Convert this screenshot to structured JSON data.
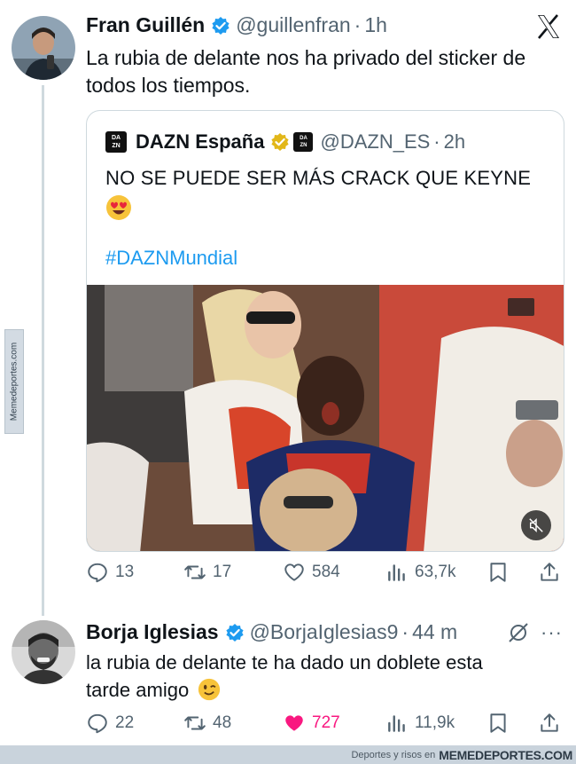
{
  "tweet1": {
    "name": "Fran Guillén",
    "handle": "@guillenfran",
    "time": "1h",
    "text_line1": "La rubia de delante nos ha privado del sticker de",
    "text_line2": "todos los tiempos."
  },
  "quote": {
    "name": "DAZN España",
    "handle": "@DAZN_ES",
    "time": "2h",
    "text": "NO SE PUEDE SER MÁS CRACK QUE KEYNE",
    "emoji": "😍",
    "hashtag": "#DAZNMundial",
    "logo_line1": "DA",
    "logo_line2": "ZN"
  },
  "tweet1_actions": {
    "replies": "13",
    "retweets": "17",
    "likes": "584",
    "views": "63,7k"
  },
  "tweet2": {
    "name": "Borja Iglesias",
    "handle": "@BorjaIglesias9",
    "time": "44 m",
    "text_line1": "la rubia de delante te ha dado un doblete esta",
    "text_line2": "tarde amigo",
    "emoji": "😉"
  },
  "tweet2_actions": {
    "replies": "22",
    "retweets": "48",
    "likes": "727",
    "views": "11,9k"
  },
  "separator": "·",
  "more": "···",
  "watermark_side": "Memedeportes.com",
  "footer": {
    "left": "Deportes y risos en",
    "right": "MEMEDEPORTES.COM"
  },
  "colors": {
    "accent": "#1d9bf0",
    "like": "#f91880",
    "muted": "#536471",
    "verified": "#1d9bf0",
    "gold": "#e2b719"
  },
  "icons": [
    "x-logo-icon",
    "verified-badge-icon",
    "reply-icon",
    "retweet-icon",
    "like-icon",
    "views-icon",
    "bookmark-icon",
    "share-icon",
    "mute-icon",
    "more-icon",
    "grok-icon"
  ]
}
